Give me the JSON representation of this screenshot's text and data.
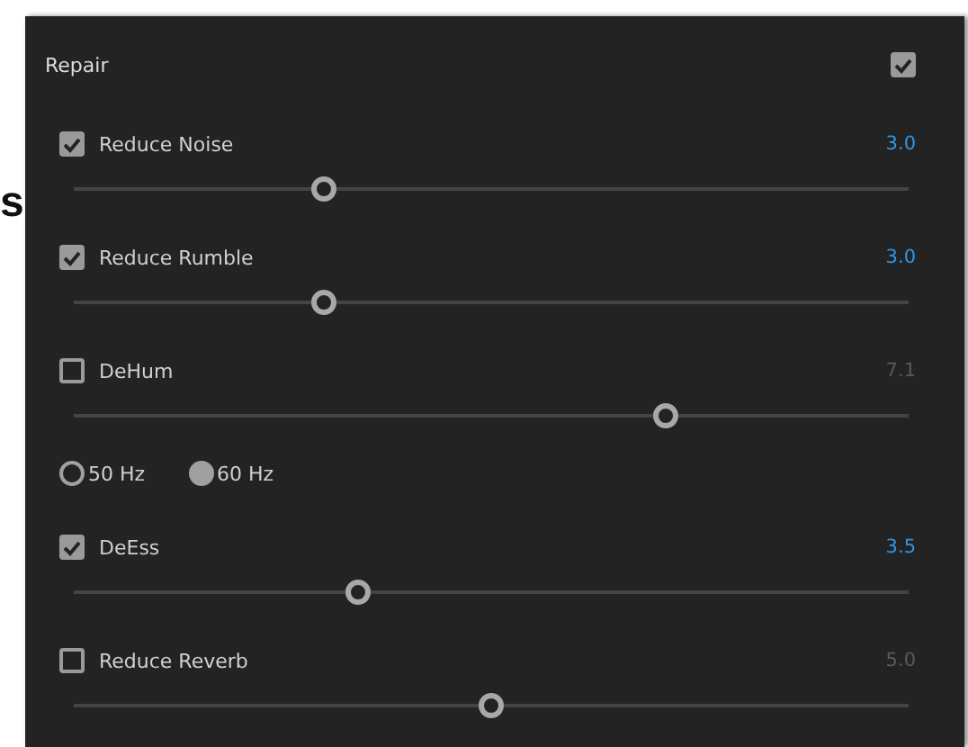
{
  "background_text": "s",
  "panel": {
    "title": "Repair",
    "checked": true
  },
  "items": [
    {
      "kind": "slider",
      "label": "Reduce Noise",
      "checked": true,
      "value": "3.0",
      "level": 0.3
    },
    {
      "kind": "slider",
      "label": "Reduce Rumble",
      "checked": true,
      "value": "3.0",
      "level": 0.3
    },
    {
      "kind": "slider",
      "label": "DeHum",
      "checked": false,
      "value": "7.1",
      "level": 0.71
    },
    {
      "kind": "radios",
      "options": [
        {
          "label": "50 Hz",
          "selected": false
        },
        {
          "label": "60 Hz",
          "selected": true
        }
      ]
    },
    {
      "kind": "slider",
      "label": "DeEss",
      "checked": true,
      "value": "3.5",
      "level": 0.34
    },
    {
      "kind": "slider",
      "label": "Reduce Reverb",
      "checked": false,
      "value": "5.0",
      "level": 0.5
    }
  ]
}
